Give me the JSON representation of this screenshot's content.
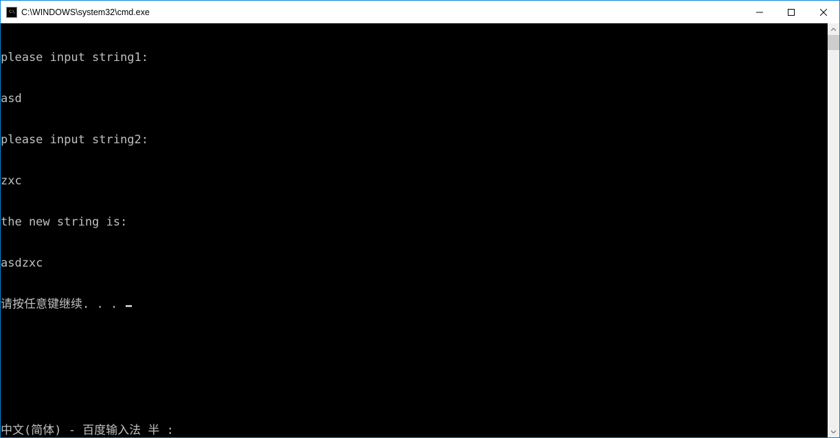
{
  "window": {
    "title": "C:\\WINDOWS\\system32\\cmd.exe"
  },
  "console": {
    "lines": [
      "please input string1:",
      "asd",
      "please input string2:",
      "zxc",
      "the new string is:",
      "asdzxc"
    ],
    "prompt": "请按任意键继续. . . ",
    "ime_status": "中文(简体) - 百度输入法 半 :"
  }
}
